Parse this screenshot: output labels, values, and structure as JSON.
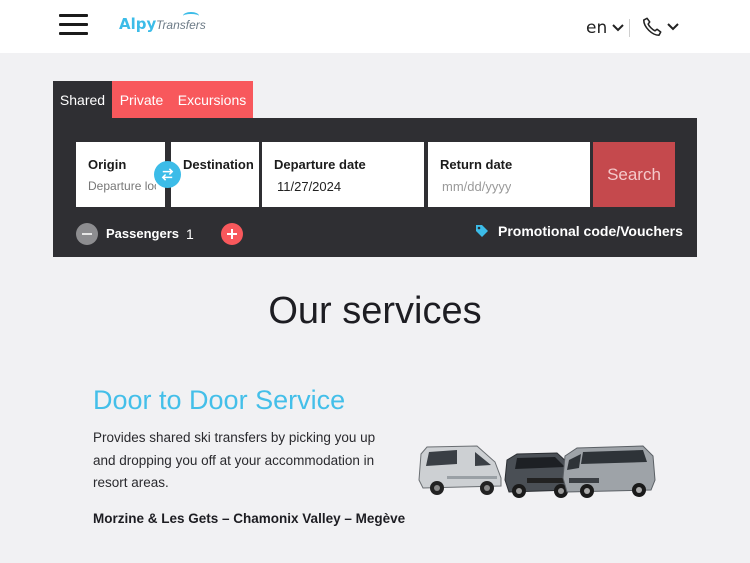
{
  "header": {
    "logo_main": "Alpy",
    "logo_sub": "Transfers",
    "language": "en"
  },
  "tabs": [
    {
      "label": "Shared",
      "active": true
    },
    {
      "label": "Private",
      "active": false
    },
    {
      "label": "Excursions",
      "active": false
    }
  ],
  "search": {
    "origin": {
      "label": "Origin",
      "placeholder": "Departure location"
    },
    "destination": {
      "label": "Destination",
      "placeholder": ""
    },
    "departure": {
      "label": "Departure date",
      "value": "11/27/2024"
    },
    "return": {
      "label": "Return date",
      "placeholder": "mm/dd/yyyy"
    },
    "search_label": "Search",
    "passengers_label": "Passengers",
    "passengers_count": "1",
    "promo_label": "Promotional code/Vouchers"
  },
  "services": {
    "title": "Our services",
    "service_title": "Door to Door Service",
    "service_desc": "Provides shared ski transfers by picking you up and dropping you off at your accommodation in resort areas.",
    "locations": "Morzine & Les Gets – Chamonix Valley – Megève"
  },
  "colors": {
    "brand_blue": "#3cbce8",
    "accent_red": "#f8585c",
    "panel_dark": "#2f2f33",
    "search_button": "#c5494d"
  },
  "icons": [
    "menu-icon",
    "phone-icon",
    "chevron-down-icon",
    "swap-icon",
    "tag-icon",
    "minus-icon",
    "plus-icon"
  ]
}
